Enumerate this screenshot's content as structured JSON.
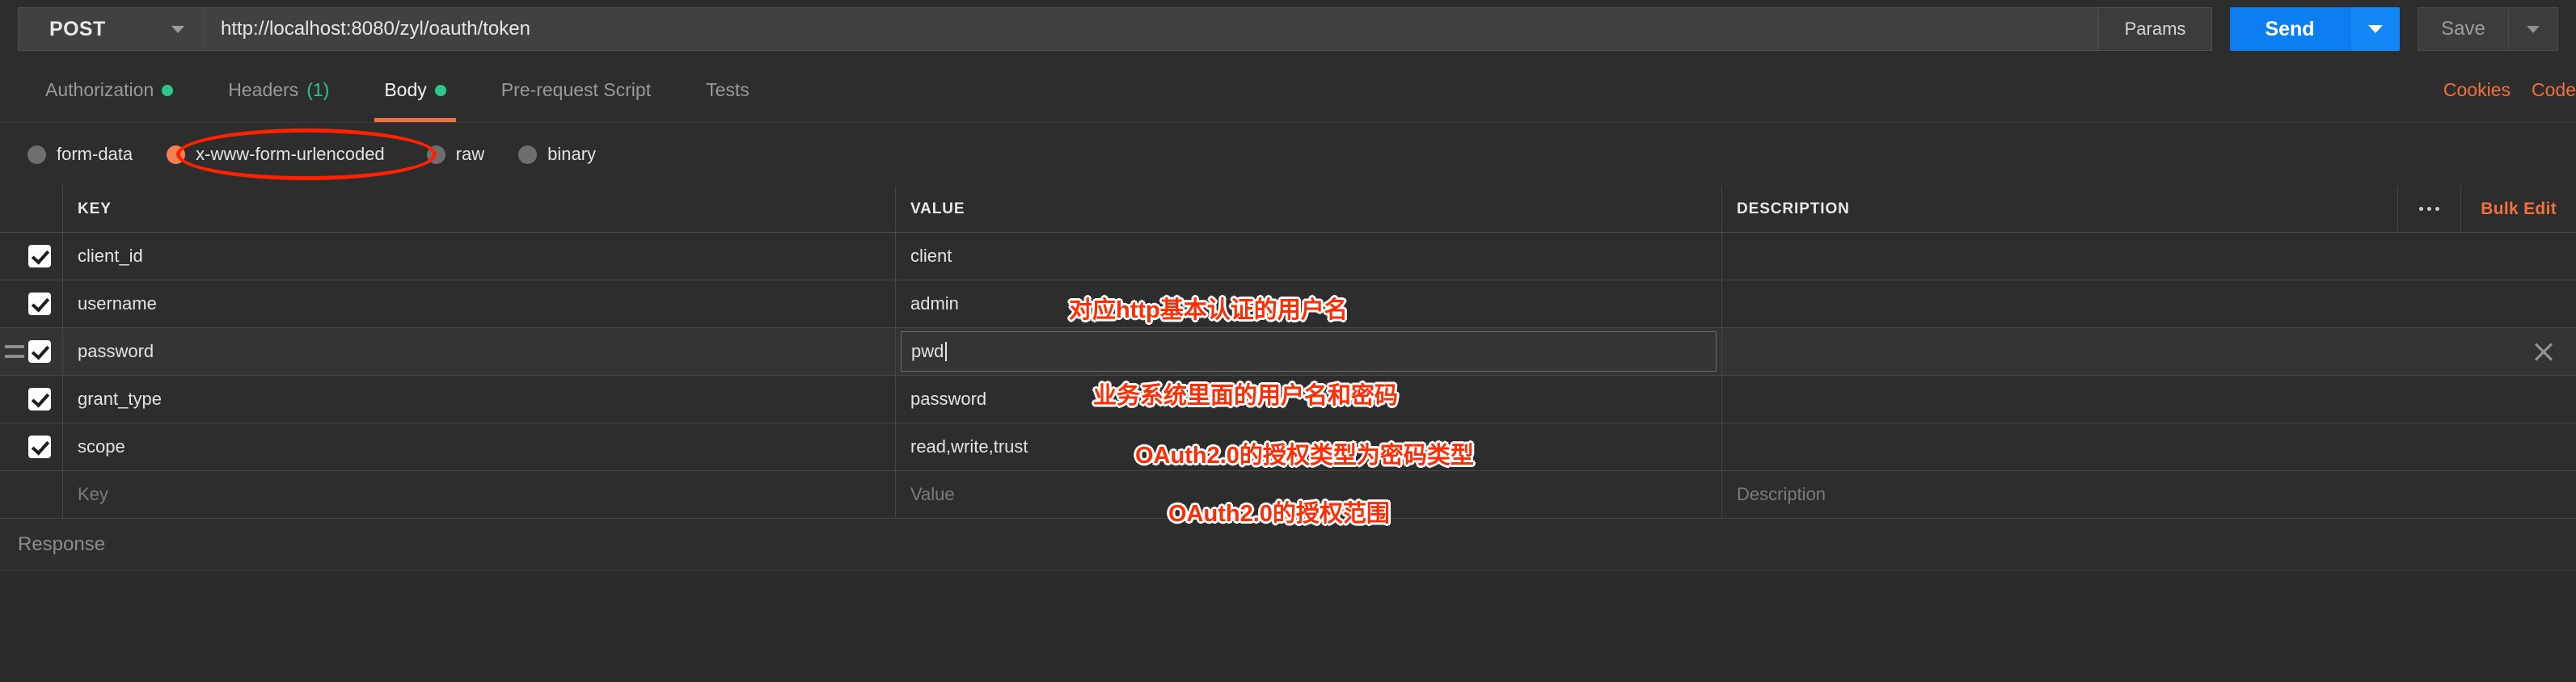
{
  "topbar": {
    "method": "POST",
    "method_caret_icon": "chevron-down-icon",
    "url": "http://localhost:8080/zyl/oauth/token",
    "url_placeholder": "Enter request URL",
    "params_label": "Params",
    "send_label": "Send",
    "send_caret_icon": "chevron-down-icon",
    "save_label": "Save",
    "save_caret_icon": "chevron-down-icon"
  },
  "tabs": {
    "items": [
      {
        "label": "Authorization",
        "indicator": "green-dot",
        "active": false
      },
      {
        "label": "Headers",
        "count": "(1)",
        "active": false
      },
      {
        "label": "Body",
        "indicator": "green-dot",
        "active": true
      },
      {
        "label": "Pre-request Script",
        "active": false
      },
      {
        "label": "Tests",
        "active": false
      }
    ],
    "cookies_label": "Cookies",
    "code_label": "Code"
  },
  "body_types": {
    "options": [
      {
        "label": "form-data",
        "selected": false
      },
      {
        "label": "x-www-form-urlencoded",
        "selected": true
      },
      {
        "label": "raw",
        "selected": false
      },
      {
        "label": "binary",
        "selected": false
      }
    ]
  },
  "table": {
    "headers": {
      "key": "KEY",
      "value": "VALUE",
      "description": "DESCRIPTION"
    },
    "actions": {
      "more_icon": "ellipsis-icon",
      "bulk_edit_label": "Bulk Edit"
    },
    "rows": [
      {
        "checked": true,
        "key": "client_id",
        "value": "client",
        "description": ""
      },
      {
        "checked": true,
        "key": "username",
        "value": "admin",
        "description": ""
      },
      {
        "checked": true,
        "key": "password",
        "value": "pwd",
        "description": "",
        "editing": true,
        "hovered": true
      },
      {
        "checked": true,
        "key": "grant_type",
        "value": "password",
        "description": ""
      },
      {
        "checked": true,
        "key": "scope",
        "value": "read,write,trust",
        "description": ""
      }
    ],
    "placeholder_row": {
      "key": "Key",
      "value": "Value",
      "description": "Description"
    }
  },
  "annotations": {
    "ellipse_target": "x-www-form-urlencoded",
    "notes": [
      {
        "text": "对应http基本认证的用户名"
      },
      {
        "text": "业务系统里面的用户名和密码"
      },
      {
        "text": "OAuth2.0的授权类型为密码类型"
      },
      {
        "text": "OAuth2.0的授权范围"
      }
    ]
  },
  "response": {
    "label": "Response"
  },
  "colors": {
    "accent_orange": "#f2713c",
    "send_blue": "#0d7ef0",
    "indicator_green": "#2fc58b",
    "annotation_red": "#fb2e05",
    "background": "#2d2d2d"
  }
}
